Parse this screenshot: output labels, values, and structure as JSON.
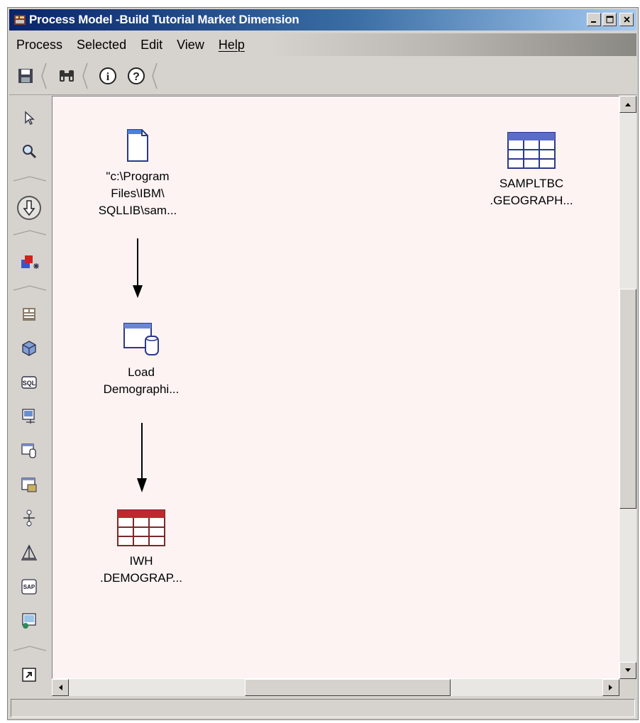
{
  "window": {
    "title": "Process Model -Build Tutorial Market Dimension",
    "title_bar_color": "#0a246a"
  },
  "menubar": {
    "items": [
      {
        "label": "Process"
      },
      {
        "label": "Selected"
      },
      {
        "label": "Edit"
      },
      {
        "label": "View"
      },
      {
        "label": "Help"
      }
    ]
  },
  "toolbar": {
    "icons": [
      "save-icon",
      "binoculars-icon",
      "info-icon",
      "help-icon"
    ]
  },
  "palette": {
    "icons": [
      "pointer-icon",
      "zoom-icon",
      "task-flow-icon",
      "transformer-icon",
      "file-icon",
      "cube-icon",
      "sql-icon",
      "program-icon",
      "load-icon",
      "export-icon",
      "split-icon",
      "warehouse-icon",
      "sap-icon",
      "web-icon",
      "shortcut-icon"
    ]
  },
  "canvas": {
    "background": "#fdf3f3",
    "nodes": [
      {
        "id": "source-file",
        "label": "\"c:\\Program\nFiles\\IBM\\\nSQLLIB\\sam...",
        "icon": "file-icon"
      },
      {
        "id": "load-step",
        "label": "Load\nDemographi...",
        "icon": "load-step-icon"
      },
      {
        "id": "target-table",
        "label": "IWH\n.DEMOGRAP...",
        "icon": "target-table-icon",
        "color": "#c0282d"
      },
      {
        "id": "source-table",
        "label": "SAMPLTBC\n.GEOGRAPH...",
        "icon": "source-table-icon",
        "color": "#5b6cc8"
      }
    ]
  },
  "statusbar": {
    "text": ""
  }
}
